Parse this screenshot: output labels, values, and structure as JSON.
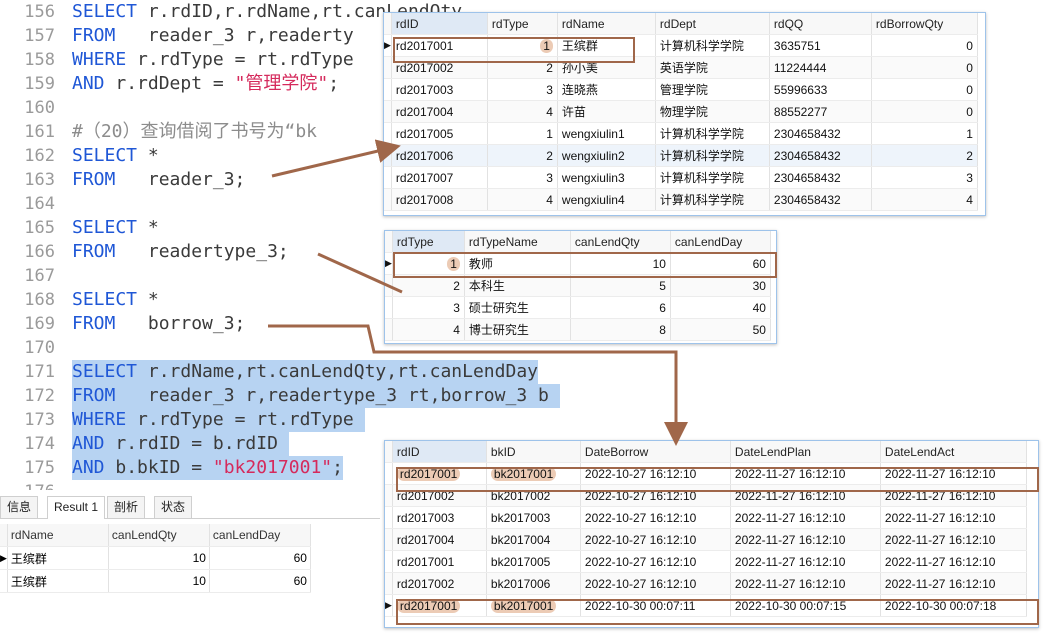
{
  "editor": {
    "lines": [
      {
        "n": "156",
        "tokens": [
          [
            "kw",
            "SELECT "
          ],
          [
            "t",
            "r.rdID,r.rdName,rt.canLendQty,"
          ]
        ]
      },
      {
        "n": "157",
        "tokens": [
          [
            "kw",
            "FROM   "
          ],
          [
            "t",
            "reader_3 r,readerty"
          ]
        ]
      },
      {
        "n": "158",
        "tokens": [
          [
            "kw",
            "WHERE "
          ],
          [
            "t",
            "r.rdType = rt.rdType"
          ]
        ]
      },
      {
        "n": "159",
        "tokens": [
          [
            "kw",
            "AND "
          ],
          [
            "t",
            "r.rdDept = "
          ],
          [
            "str",
            "\"管理学院\""
          ],
          [
            "t",
            ";"
          ]
        ]
      },
      {
        "n": "160",
        "tokens": []
      },
      {
        "n": "161",
        "tokens": [
          [
            "cm",
            "#（20）查询借阅了书号为“bk"
          ]
        ]
      },
      {
        "n": "162",
        "tokens": [
          [
            "kw",
            "SELECT "
          ],
          [
            "t",
            "*"
          ]
        ]
      },
      {
        "n": "163",
        "tokens": [
          [
            "kw",
            "FROM   "
          ],
          [
            "t",
            "reader_3;"
          ]
        ]
      },
      {
        "n": "164",
        "tokens": []
      },
      {
        "n": "165",
        "tokens": [
          [
            "kw",
            "SELECT "
          ],
          [
            "t",
            "*"
          ]
        ]
      },
      {
        "n": "166",
        "tokens": [
          [
            "kw",
            "FROM   "
          ],
          [
            "t",
            "readertype_3;"
          ]
        ]
      },
      {
        "n": "167",
        "tokens": []
      },
      {
        "n": "168",
        "tokens": [
          [
            "kw",
            "SELECT "
          ],
          [
            "t",
            "*"
          ]
        ]
      },
      {
        "n": "169",
        "tokens": [
          [
            "kw",
            "FROM   "
          ],
          [
            "t",
            "borrow_3;"
          ]
        ]
      },
      {
        "n": "170",
        "tokens": []
      },
      {
        "n": "171",
        "sel": true,
        "tokens": [
          [
            "kw",
            "SELECT "
          ],
          [
            "t",
            "r.rdName,rt.canLendQty,rt.canLendDay"
          ]
        ]
      },
      {
        "n": "172",
        "sel": true,
        "tokens": [
          [
            "kw",
            "FROM   "
          ],
          [
            "t",
            "reader_3 r,readertype_3 rt,borrow_3 b "
          ]
        ]
      },
      {
        "n": "173",
        "sel": true,
        "tokens": [
          [
            "kw",
            "WHERE "
          ],
          [
            "t",
            "r.rdType = rt.rdType "
          ]
        ]
      },
      {
        "n": "174",
        "sel": true,
        "tokens": [
          [
            "kw",
            "AND "
          ],
          [
            "t",
            "r.rdID = b.rdID "
          ]
        ]
      },
      {
        "n": "175",
        "sel": true,
        "tokens": [
          [
            "kw",
            "AND "
          ],
          [
            "t",
            "b.bkID = "
          ],
          [
            "str",
            "\"bk2017001\""
          ],
          [
            "t",
            ";"
          ]
        ]
      },
      {
        "n": "176",
        "tokens": []
      }
    ]
  },
  "bottom": {
    "tabs": [
      "信息",
      "Result 1",
      "剖析",
      "状态"
    ],
    "active_tab": 1,
    "columns": [
      "rdName",
      "canLendQty",
      "canLendDay"
    ],
    "rows": [
      [
        "王缤群",
        "10",
        "60"
      ],
      [
        "王缤群",
        "10",
        "60"
      ]
    ]
  },
  "reader": {
    "columns": [
      "rdID",
      "rdType",
      "rdName",
      "rdDept",
      "rdQQ",
      "rdBorrowQty"
    ],
    "rows": [
      [
        "rd2017001",
        "1",
        "王缤群",
        "计算机科学学院",
        "3635751",
        "0"
      ],
      [
        "rd2017002",
        "2",
        "孙小美",
        "英语学院",
        "11224444",
        "0"
      ],
      [
        "rd2017003",
        "3",
        "连晓燕",
        "管理学院",
        "55996633",
        "0"
      ],
      [
        "rd2017004",
        "4",
        "许苗",
        "物理学院",
        "88552277",
        "0"
      ],
      [
        "rd2017005",
        "1",
        "wengxiulin1",
        "计算机科学学院",
        "2304658432",
        "1"
      ],
      [
        "rd2017006",
        "2",
        "wengxiulin2",
        "计算机科学学院",
        "2304658432",
        "2"
      ],
      [
        "rd2017007",
        "3",
        "wengxiulin3",
        "计算机科学学院",
        "2304658432",
        "3"
      ],
      [
        "rd2017008",
        "4",
        "wengxiulin4",
        "计算机科学学院",
        "2304658432",
        "4"
      ]
    ]
  },
  "readertype": {
    "columns": [
      "rdType",
      "rdTypeName",
      "canLendQty",
      "canLendDay"
    ],
    "rows": [
      [
        "1",
        "教师",
        "10",
        "60"
      ],
      [
        "2",
        "本科生",
        "5",
        "30"
      ],
      [
        "3",
        "硕士研究生",
        "6",
        "40"
      ],
      [
        "4",
        "博士研究生",
        "8",
        "50"
      ]
    ]
  },
  "borrow": {
    "columns": [
      "rdID",
      "bkID",
      "DateBorrow",
      "DateLendPlan",
      "DateLendAct"
    ],
    "rows": [
      [
        "rd2017001",
        "bk2017001",
        "2022-10-27 16:12:10",
        "2022-11-27 16:12:10",
        "2022-11-27 16:12:10"
      ],
      [
        "rd2017002",
        "bk2017002",
        "2022-10-27 16:12:10",
        "2022-11-27 16:12:10",
        "2022-11-27 16:12:10"
      ],
      [
        "rd2017003",
        "bk2017003",
        "2022-10-27 16:12:10",
        "2022-11-27 16:12:10",
        "2022-11-27 16:12:10"
      ],
      [
        "rd2017004",
        "bk2017004",
        "2022-10-27 16:12:10",
        "2022-11-27 16:12:10",
        "2022-11-27 16:12:10"
      ],
      [
        "rd2017001",
        "bk2017005",
        "2022-10-27 16:12:10",
        "2022-11-27 16:12:10",
        "2022-11-27 16:12:10"
      ],
      [
        "rd2017002",
        "bk2017006",
        "2022-10-27 16:12:10",
        "2022-11-27 16:12:10",
        "2022-11-27 16:12:10"
      ],
      [
        "rd2017001",
        "bk2017001",
        "2022-10-30 00:07:11",
        "2022-10-30 00:07:15",
        "2022-10-30 00:07:18"
      ]
    ]
  },
  "colors": {
    "keyword": "#1f57d6",
    "string": "#d52a5c",
    "comment": "#8c8c8c",
    "selection": "#b7d3f2",
    "annotation": "#a0674a"
  }
}
